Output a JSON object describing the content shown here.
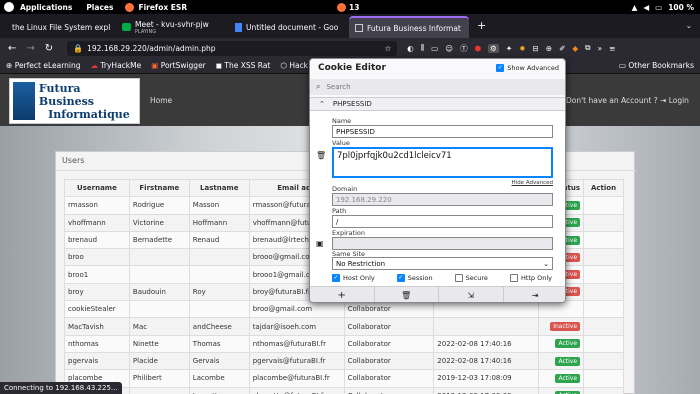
{
  "os_bar": {
    "applications": "Applications",
    "places": "Places",
    "firefox": "Firefox ESR",
    "clock": "13",
    "battery": "100 %"
  },
  "tabs": [
    {
      "title": "the Linux File System expl",
      "icon": "youtube-icon"
    },
    {
      "title": "Meet - kvu-svhr-pjw",
      "sub": "PLAYING",
      "icon": "meet-icon"
    },
    {
      "title": "Untitled document - Goo",
      "icon": "docs-icon"
    },
    {
      "title": "Futura Business Informat",
      "icon": "page-icon"
    }
  ],
  "new_tab": "+",
  "url": "192.168.29.220/admin/admin.php",
  "url_host": "192.168.29.220",
  "bookmarks": [
    "Perfect eLearning",
    "TryHackMe",
    "PortSwigger",
    "The XSS Rat",
    "Hack The Box"
  ],
  "other_bookmarks": "Other Bookmarks",
  "site": {
    "logo_line1": "Futura Business",
    "logo_line2": "Informatique",
    "home": "Home",
    "no_account": "Don't have an Account ?",
    "login": "Login",
    "users_title": "Users"
  },
  "table": {
    "headers": [
      "Username",
      "Firstname",
      "Lastname",
      "Email add",
      "",
      "atus",
      "Action"
    ],
    "rows": [
      [
        "rmasson",
        "Rodrigue",
        "Masson",
        "rmasson@futuraBI.fr",
        "",
        "Active"
      ],
      [
        "vhoffmann",
        "Victorine",
        "Hoffmann",
        "vhoffmann@futuraBI.",
        "",
        "Active"
      ],
      [
        "brenaud",
        "Bernadette",
        "Renaud",
        "brenaud@lrtechnolog",
        "",
        "Active"
      ],
      [
        "broo",
        "",
        "",
        "brooo@gmail.com",
        "",
        "Inactive"
      ],
      [
        "broo1",
        "",
        "",
        "brooo1@gmail.com",
        "",
        "Inactive"
      ],
      [
        "broy",
        "Baudouin",
        "Roy",
        "broy@futuraBI.fr",
        "",
        "Inactive"
      ],
      [
        "cookieStealer",
        "",
        "",
        "broo@gmail.com",
        "Collaborator",
        ""
      ],
      [
        "MacTavish",
        "Mac",
        "andCheese",
        "tajdar@isoeh.com",
        "Collaborator",
        "Inactive"
      ],
      [
        "nthomas",
        "Ninette",
        "Thomas",
        "nthomas@futuraBI.fr",
        "Collaborator",
        "2022-02-08 17:40:16",
        "Active"
      ],
      [
        "pgervais",
        "Placide",
        "Gervais",
        "pgervais@futuraBI.fr",
        "Collaborator",
        "2022-02-08 17:40:16",
        "Active"
      ],
      [
        "placombe",
        "Philibert",
        "Lacombe",
        "placombe@futuraBI.fr",
        "Collaborator",
        "2019-12-03 17:08:09",
        "Active"
      ],
      [
        "",
        "",
        "Lamotte",
        "slamotte@futuraBI.fr",
        "Collaborator",
        "2019-12-03 17:08:09",
        "Active"
      ]
    ]
  },
  "status_text": "Connecting to 192.168.43.225...",
  "cookie_editor": {
    "title": "Cookie Editor",
    "show_advanced": "Show Advanced",
    "search_placeholder": "Search",
    "cookie_name_header": "PHPSESSID",
    "name_label": "Name",
    "name_value": "PHPSESSID",
    "value_label": "Value",
    "value_value": "7pl0jprfqjk0u2cd1lcleicv71",
    "hide_advanced": "Hide Advanced",
    "domain_label": "Domain",
    "domain_value": "192.168.29.220",
    "path_label": "Path",
    "path_value": "/",
    "expiration_label": "Expiration",
    "expiration_value": "",
    "samesite_label": "Same Site",
    "samesite_value": "No Restriction",
    "host_only": "Host Only",
    "session": "Session",
    "secure": "Secure",
    "http_only": "Http Only",
    "host_only_checked": true,
    "session_checked": true,
    "secure_checked": false,
    "http_only_checked": false
  },
  "colors": {
    "active": "#2ea44f",
    "inactive": "#d9534f",
    "accent": "#0a84ff"
  }
}
